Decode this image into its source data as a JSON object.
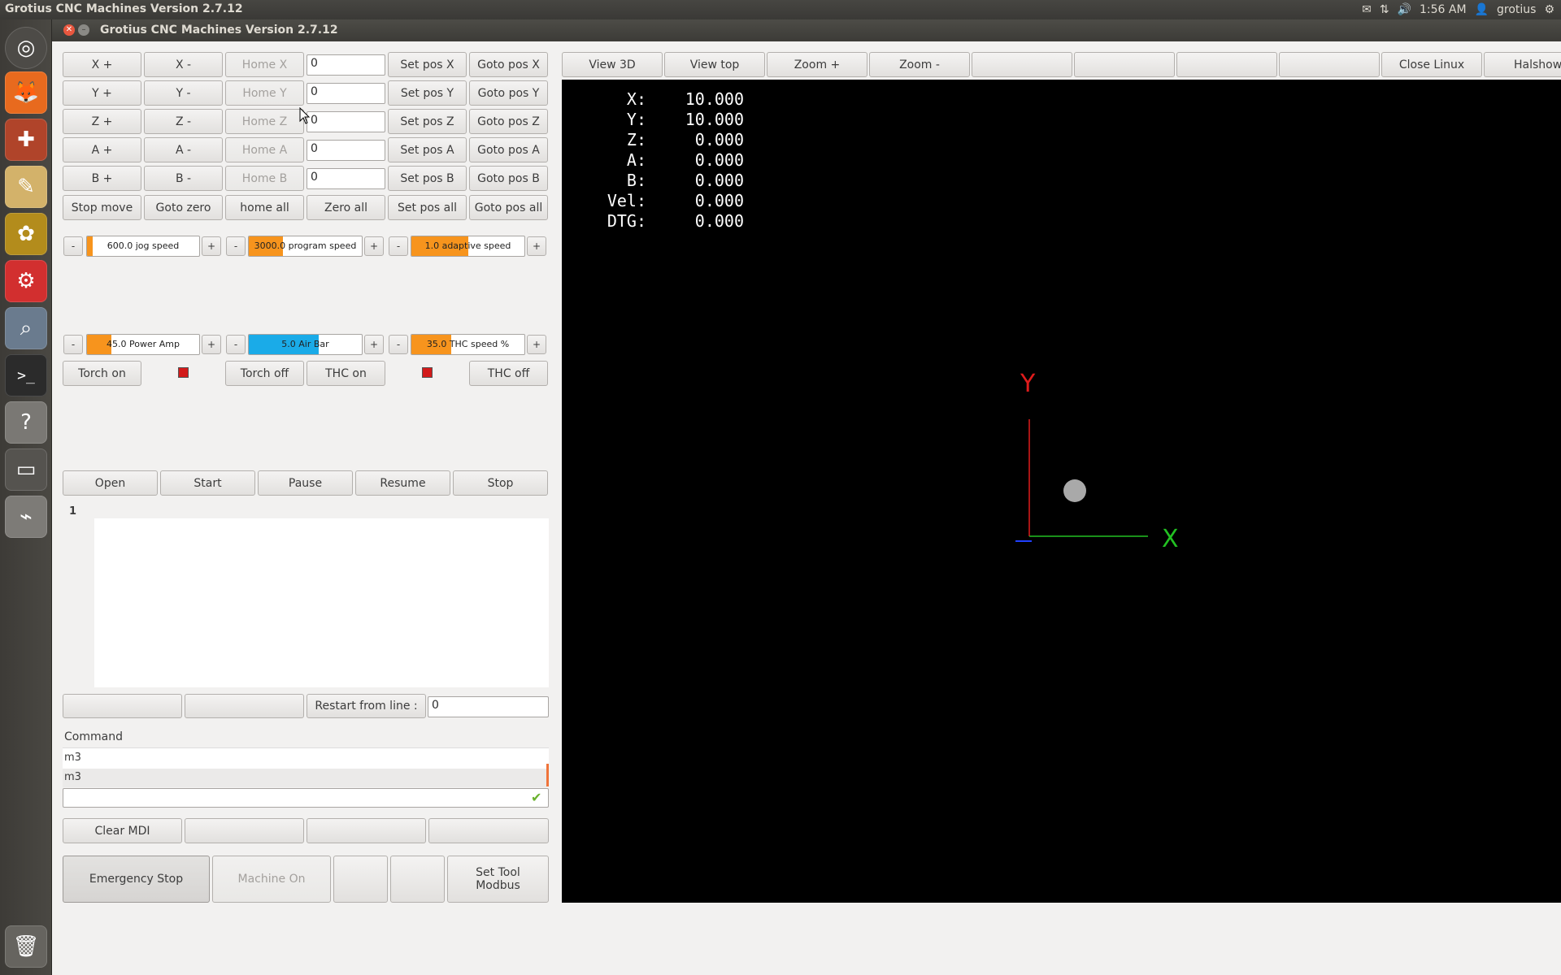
{
  "system": {
    "title": "Grotius CNC Machines Version 2.7.12",
    "time": "1:56 AM",
    "user": "grotius"
  },
  "window": {
    "title": "Grotius CNC Machines Version 2.7.12"
  },
  "axes_controls": [
    {
      "plus": "X +",
      "minus": "X -",
      "home": "Home X",
      "value": "0",
      "set": "Set pos X",
      "goto": "Goto pos X"
    },
    {
      "plus": "Y +",
      "minus": "Y -",
      "home": "Home Y",
      "value": "0",
      "set": "Set pos Y",
      "goto": "Goto pos Y"
    },
    {
      "plus": "Z +",
      "minus": "Z -",
      "home": "Home Z",
      "value": "0",
      "set": "Set pos Z",
      "goto": "Goto pos Z"
    },
    {
      "plus": "A +",
      "minus": "A -",
      "home": "Home A",
      "value": "0",
      "set": "Set pos A",
      "goto": "Goto pos A"
    },
    {
      "plus": "B +",
      "minus": "B -",
      "home": "Home B",
      "value": "0",
      "set": "Set pos B",
      "goto": "Goto pos B"
    }
  ],
  "all_row": {
    "stop_move": "Stop move",
    "goto_zero": "Goto zero",
    "home_all": "home all",
    "zero_all": "Zero all",
    "set_pos_all": "Set pos all",
    "goto_pos_all": "Goto pos all"
  },
  "minus": "-",
  "plus": "+",
  "sliders": {
    "jog": {
      "label": "600.0 jog speed",
      "fill": 0.05,
      "color": "#f7941d"
    },
    "program": {
      "label": "3000.0 program speed",
      "fill": 0.3,
      "color": "#f7941d"
    },
    "adaptive": {
      "label": "1.0 adaptive speed",
      "fill": 0.5,
      "color": "#f7941d"
    },
    "power": {
      "label": "45.0 Power Amp",
      "fill": 0.22,
      "color": "#f7941d"
    },
    "air": {
      "label": "5.0 Air Bar",
      "fill": 0.62,
      "color": "#1aabe8"
    },
    "thc": {
      "label": "35.0 THC speed %",
      "fill": 0.35,
      "color": "#f7941d"
    }
  },
  "torch": {
    "on": "Torch on",
    "off": "Torch off",
    "thc_on": "THC on",
    "thc_off": "THC off"
  },
  "program": {
    "open": "Open",
    "start": "Start",
    "pause": "Pause",
    "resume": "Resume",
    "stop": "Stop",
    "line_number": "1"
  },
  "restart": {
    "label": "Restart from line :",
    "value": "0"
  },
  "mdi": {
    "header": "Command",
    "history": [
      "m3",
      "m3"
    ],
    "input": "",
    "clear": "Clear MDI"
  },
  "bottom": {
    "estop": "Emergency Stop",
    "machine_on": "Machine On",
    "set_tool_1": "Set Tool",
    "set_tool_2": "Modbus"
  },
  "toolbar": {
    "view3d": "View 3D",
    "viewtop": "View top",
    "zoom_in": "Zoom +",
    "zoom_out": "Zoom -",
    "close_linux": "Close Linux",
    "halshow": "Halshow"
  },
  "dro": [
    {
      "k": "X:",
      "v": "10.000"
    },
    {
      "k": "Y:",
      "v": "10.000"
    },
    {
      "k": "Z:",
      "v": "0.000"
    },
    {
      "k": "A:",
      "v": "0.000"
    },
    {
      "k": "B:",
      "v": "0.000"
    },
    {
      "k": "Vel:",
      "v": "0.000"
    },
    {
      "k": "DTG:",
      "v": "0.000"
    }
  ],
  "axis_labels": {
    "x": "X",
    "y": "Y"
  },
  "colors": {
    "accent_orange": "#f7941d",
    "air_blue": "#1aabe8",
    "led_red": "#d21a1a",
    "x_axis": "#22c022",
    "y_axis": "#e01c1c"
  }
}
